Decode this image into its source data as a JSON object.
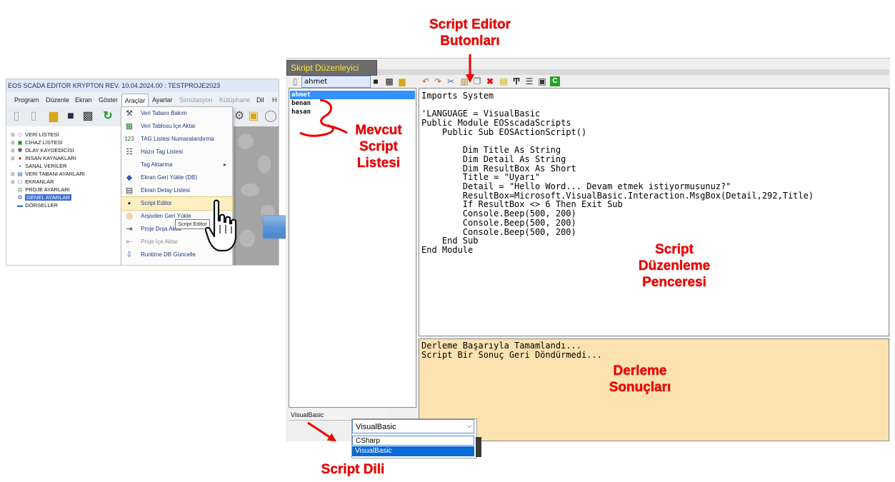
{
  "main_app": {
    "title": "EOS SCADA EDITOR KRYPTON REV. 10.04.2024.00 : TESTPROJE2023",
    "menu": [
      "Program",
      "Düzenle",
      "Ekran",
      "Göster",
      "Araçlar",
      "Ayarlar",
      "Simülasyon",
      "Kütüphane",
      "Dil",
      "H"
    ],
    "active_menu": "Araçlar",
    "tree": [
      {
        "label": "VERİ LİSTESİ",
        "icon": "tag-icon"
      },
      {
        "label": "CİHAZ LİSTESİ",
        "icon": "device-icon"
      },
      {
        "label": "OLAY KAYDEDİCİSİ",
        "icon": "event-icon"
      },
      {
        "label": "İNSAN KAYNAKLARI",
        "icon": "person-icon"
      },
      {
        "label": "SANAL VERİLER",
        "icon": "virtual-icon"
      },
      {
        "label": "VERİ TABANI AYARLARI",
        "icon": "database-icon"
      },
      {
        "label": "EKRANLAR",
        "icon": "screen-icon"
      },
      {
        "label": "PROJE AYARLARI",
        "icon": "project-icon"
      },
      {
        "label": "GENEL AYARLAR",
        "icon": "gear-icon"
      },
      {
        "label": "GÖRSELLER",
        "icon": "image-icon"
      }
    ],
    "tools_menu": [
      {
        "label": "Veri Tabanı Bakım",
        "icon": "tools-icon"
      },
      {
        "label": "Veri Tablosu İçe Aktar",
        "icon": "import-table-icon"
      },
      {
        "label": "TAG Listesi Numaralandırma",
        "icon": "numbering-icon"
      },
      {
        "label": "Hazır Tag Listesi",
        "icon": "list-icon"
      },
      {
        "label": "Tag Aktarma",
        "icon": "transfer-icon"
      },
      {
        "label": "Ekran Geri Yükle (DB)",
        "icon": "restore-icon"
      },
      {
        "label": "Ekran Detay Listesi",
        "icon": "detail-list-icon"
      },
      {
        "label": "Script Editor",
        "icon": "script-icon"
      },
      {
        "label": "Arşivden Geri Yükle",
        "icon": "archive-icon"
      },
      {
        "label": "Proje Dışa Aktar",
        "icon": "export-icon"
      },
      {
        "label": "Proje İçe Aktar",
        "icon": "project-import-icon"
      },
      {
        "label": "Runtime DB Güncelle",
        "icon": "runtime-db-icon"
      }
    ],
    "tooltip": "Script Editor"
  },
  "editor": {
    "tab_title": "Skript Düzenleyici",
    "script_name": "ahmet",
    "scripts": [
      "ahmet",
      "benan",
      "hasan"
    ],
    "selected_script": "ahmet",
    "language": "VisualBasic",
    "code_lines": [
      "Imports System",
      "",
      "'LANGUAGE = VisualBasic",
      "Public Module EOSscadaScripts",
      "    Public Sub EOSActionScript()",
      "",
      "        Dim Title As String",
      "        Dim Detail As String",
      "        Dim ResultBox As Short",
      "        Title = \"Uyarı\"",
      "        Detail = \"Hello Word... Devam etmek istiyormusunuz?\"",
      "        ResultBox=Microsoft.VisualBasic.Interaction.MsgBox(Detail,292,Title)",
      "        If ResultBox <> 6 Then Exit Sub",
      "        Console.Beep(500, 200)",
      "        Console.Beep(500, 200)",
      "        Console.Beep(500, 200)",
      "    End Sub",
      "End Module"
    ],
    "output_lines": [
      "Derleme Başarıyla Tamamlandı...",
      "Script Bir Sonuç Geri Döndürmedi..."
    ],
    "toolbar_icons": [
      "undo-icon",
      "redo-icon",
      "cut-icon",
      "paste-icon",
      "copy-icon",
      "delete-icon",
      "note-icon",
      "text-format-icon",
      "align-icon",
      "page-icon",
      "compile-icon"
    ]
  },
  "language_combo": {
    "selected": "VisualBasic",
    "options": [
      "CSharp",
      "VisualBasic"
    ],
    "highlighted": "VisualBasic"
  },
  "annotations": {
    "toolbar": [
      "Script Editor",
      "Butonları"
    ],
    "script_list": [
      "Mevcut",
      "Script",
      "Listesi"
    ],
    "edit_window": [
      "Script",
      "Düzenleme",
      "Penceresi"
    ],
    "results": [
      "Derleme",
      "Sonuçları"
    ],
    "language": "Script Dili"
  },
  "colors": {
    "annotation_red": "#ee0000",
    "selection_blue": "#3390ff",
    "output_bg": "#fde2b1",
    "tab_text": "#ffe23a"
  }
}
